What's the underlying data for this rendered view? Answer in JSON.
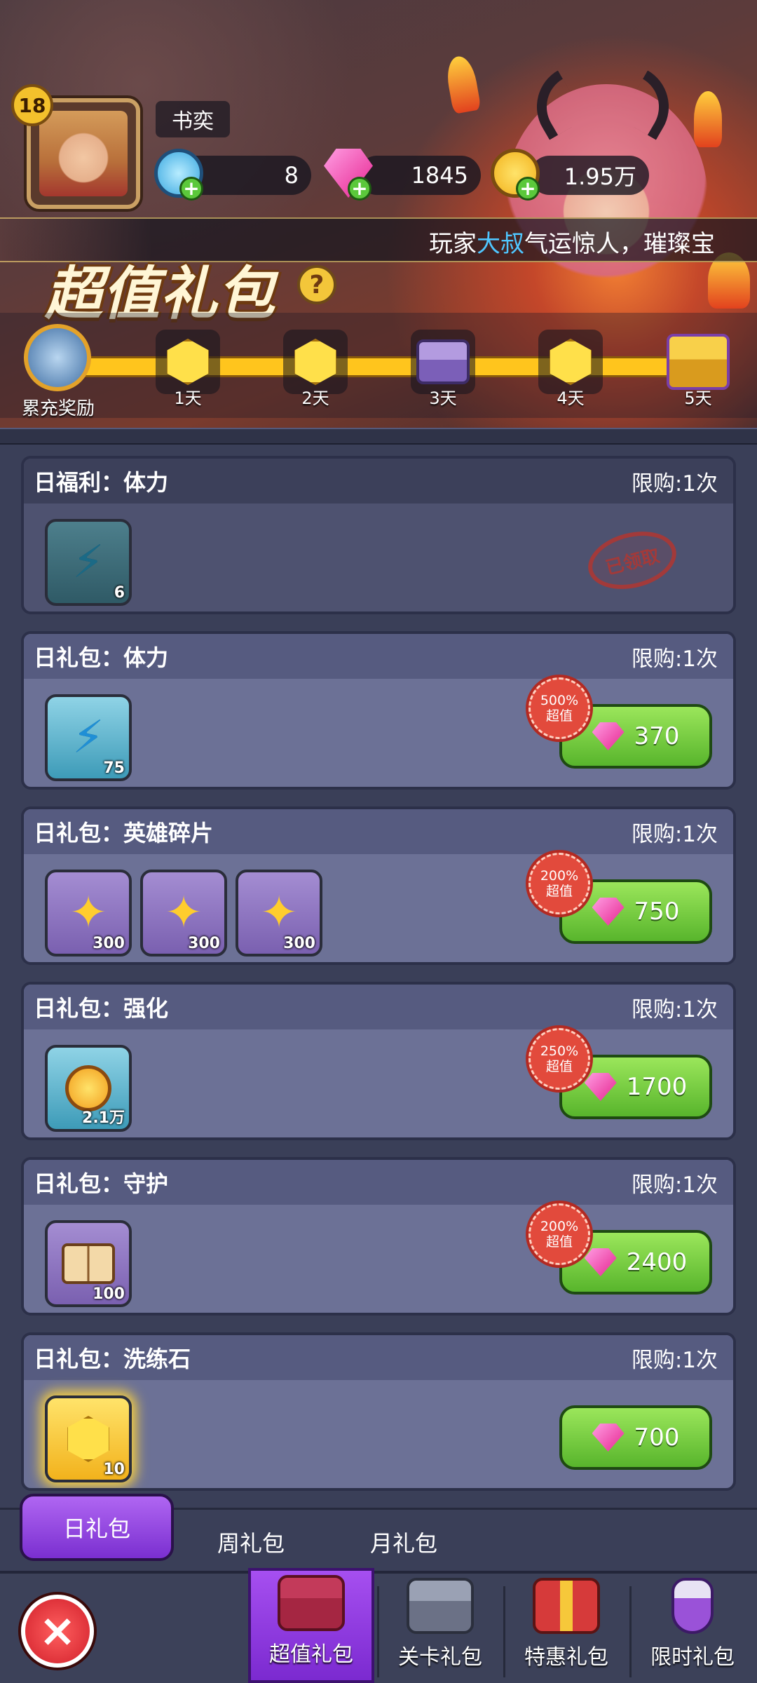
{
  "player": {
    "level": "18",
    "name": "书奕"
  },
  "resources": [
    {
      "name": "stamina-crystal",
      "value": "8",
      "color": "#3aa8e0"
    },
    {
      "name": "diamond",
      "value": "1845",
      "color": "#e6238f"
    },
    {
      "name": "coin",
      "value": "1.95万",
      "color": "#f3c12c"
    }
  ],
  "ticker": {
    "prefix": "玩家",
    "highlight": "大叔",
    "suffix": "气运惊人，璀璨宝"
  },
  "banner": {
    "title": "超值礼包",
    "help_icon": "?"
  },
  "recharge": {
    "label": "累充奖励",
    "nodes": [
      {
        "label": "1天",
        "icon": "yellow-gem-icon"
      },
      {
        "label": "2天",
        "icon": "yellow-gem-icon"
      },
      {
        "label": "3天",
        "icon": "purple-chest-icon"
      },
      {
        "label": "4天",
        "icon": "yellow-gem-icon"
      },
      {
        "label": "5天",
        "icon": "gold-chest-icon"
      }
    ]
  },
  "packs": [
    {
      "title": "日福利：体力",
      "limit": "限购:1次",
      "items": [
        {
          "icon": "lightning-icon",
          "count": "6"
        }
      ],
      "claimed_label": "已领取"
    },
    {
      "title": "日礼包：体力",
      "limit": "限购:1次",
      "items": [
        {
          "icon": "lightning-icon",
          "count": "75"
        }
      ],
      "badge_pct": "500%",
      "badge_text": "超值",
      "price": "370"
    },
    {
      "title": "日礼包：英雄碎片",
      "limit": "限购:1次",
      "items": [
        {
          "icon": "puzzle-piece-icon",
          "count": "300"
        },
        {
          "icon": "puzzle-piece-icon",
          "count": "300"
        },
        {
          "icon": "puzzle-piece-icon",
          "count": "300"
        }
      ],
      "badge_pct": "200%",
      "badge_text": "超值",
      "price": "750"
    },
    {
      "title": "日礼包：强化",
      "limit": "限购:1次",
      "items": [
        {
          "icon": "coin-icon",
          "count": "2.1万"
        }
      ],
      "badge_pct": "250%",
      "badge_text": "超值",
      "price": "1700"
    },
    {
      "title": "日礼包：守护",
      "limit": "限购:1次",
      "items": [
        {
          "icon": "spell-book-icon",
          "count": "100"
        }
      ],
      "badge_pct": "200%",
      "badge_text": "超值",
      "price": "2400"
    },
    {
      "title": "日礼包：洗练石",
      "limit": "限购:1次",
      "items": [
        {
          "icon": "yellow-gem-icon",
          "count": "10"
        }
      ],
      "price": "700"
    }
  ],
  "sub_tabs": [
    {
      "label": "日礼包",
      "active": true
    },
    {
      "label": "周礼包"
    },
    {
      "label": "月礼包"
    }
  ],
  "bottom_tabs": [
    {
      "label": "超值礼包",
      "active": true
    },
    {
      "label": "关卡礼包"
    },
    {
      "label": "特惠礼包"
    },
    {
      "label": "限时礼包"
    }
  ],
  "close_icon": "×"
}
